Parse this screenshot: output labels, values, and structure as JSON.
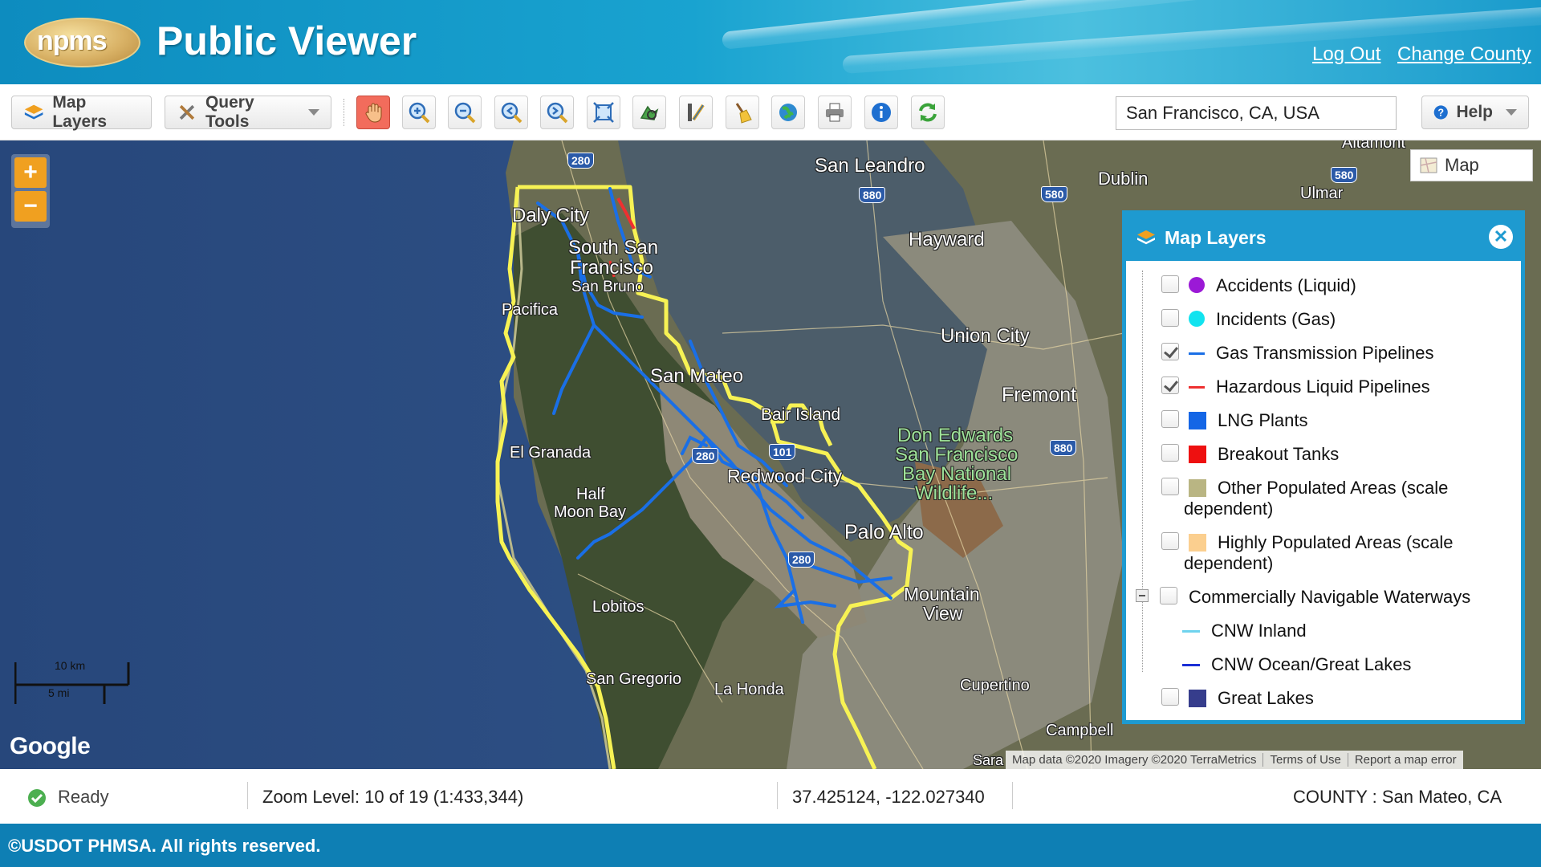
{
  "header": {
    "logo_text": "npms",
    "title": "Public Viewer",
    "log_out": "Log Out",
    "change_county": "Change County"
  },
  "toolbar": {
    "map_layers": "Map Layers",
    "query_tools": "Query Tools",
    "location_value": "San Francisco, CA, USA",
    "help": "Help",
    "tools": [
      "pan-icon",
      "zoom-in-icon",
      "zoom-out-icon",
      "zoom-previous-icon",
      "zoom-next-icon",
      "full-extent-icon",
      "identify-icon",
      "measure-icon",
      "clear-icon",
      "globe-icon",
      "print-icon",
      "info-icon",
      "refresh-icon"
    ]
  },
  "map": {
    "map_type": "Map",
    "zoom_in": "+",
    "zoom_out": "−",
    "scale_km": "10 km",
    "scale_mi": "5 mi",
    "google": "Google",
    "attribution": [
      "Map data ©2020 Imagery ©2020 TerraMetrics",
      "Terms of Use",
      "Report a map error"
    ],
    "places": [
      {
        "t": "San Leandro"
      },
      {
        "t": "Dublin"
      },
      {
        "t": "Hayward"
      },
      {
        "t": "Daly City"
      },
      {
        "t": "South San"
      },
      {
        "t": "Francisco"
      },
      {
        "t": "San Bruno"
      },
      {
        "t": "Pacifica"
      },
      {
        "t": "San Mateo"
      },
      {
        "t": "Union City"
      },
      {
        "t": "Fremont"
      },
      {
        "t": "Bair Island"
      },
      {
        "t": "Don Edwards"
      },
      {
        "t": "San Francisco"
      },
      {
        "t": "Bay National"
      },
      {
        "t": "Wildlife..."
      },
      {
        "t": "El Granada"
      },
      {
        "t": "Redwood City"
      },
      {
        "t": "Half"
      },
      {
        "t": "Moon Bay"
      },
      {
        "t": "Palo Alto"
      },
      {
        "t": "Mountain"
      },
      {
        "t": "View"
      },
      {
        "t": "Lobitos"
      },
      {
        "t": "San Gregorio"
      },
      {
        "t": "La Honda"
      },
      {
        "t": "Cupertino"
      },
      {
        "t": "Campbell"
      },
      {
        "t": "Altamont"
      },
      {
        "t": "Ulmar"
      },
      {
        "t": "Sara"
      }
    ],
    "shields": [
      "280",
      "880",
      "580",
      "580",
      "880",
      "280",
      "101",
      "280"
    ]
  },
  "layers": {
    "title": "Map Layers",
    "close": "✕",
    "items": [
      {
        "label": "Accidents (Liquid)",
        "checked": false,
        "symbol": "dot",
        "color": "#9b19d6"
      },
      {
        "label": "Incidents (Gas)",
        "checked": false,
        "symbol": "dot",
        "color": "#12e3ef"
      },
      {
        "label": "Gas Transmission Pipelines",
        "checked": true,
        "symbol": "line",
        "color": "#1a6fe6"
      },
      {
        "label": "Hazardous Liquid Pipelines",
        "checked": true,
        "symbol": "line",
        "color": "#ee3030"
      },
      {
        "label": "LNG Plants",
        "checked": false,
        "symbol": "sq",
        "color": "#1466e6"
      },
      {
        "label": "Breakout Tanks",
        "checked": false,
        "symbol": "sq",
        "color": "#ee1010"
      },
      {
        "label": "Other Populated Areas (scale",
        "label2": "dependent)",
        "checked": false,
        "symbol": "sq",
        "color": "#b9b583"
      },
      {
        "label": "Highly Populated Areas (scale",
        "label2": "dependent)",
        "checked": false,
        "symbol": "sq",
        "color": "#fbcf8f"
      },
      {
        "label": "Commercially Navigable Waterways",
        "checked": false,
        "symbol": "none",
        "color": ""
      },
      {
        "label": "CNW Inland",
        "checked": null,
        "symbol": "line",
        "color": "#6fd3ee"
      },
      {
        "label": "CNW Ocean/Great Lakes",
        "checked": null,
        "symbol": "line",
        "color": "#1b2fd6"
      },
      {
        "label": "Great Lakes",
        "checked": false,
        "symbol": "sq",
        "color": "#363d8c"
      }
    ]
  },
  "status": {
    "ready": "Ready",
    "zoom": "Zoom Level: 10 of 19 (1:433,344)",
    "coords": "37.425124, -122.027340",
    "county": "COUNTY : San Mateo, CA"
  },
  "footer": "©USDOT PHMSA. All rights reserved."
}
